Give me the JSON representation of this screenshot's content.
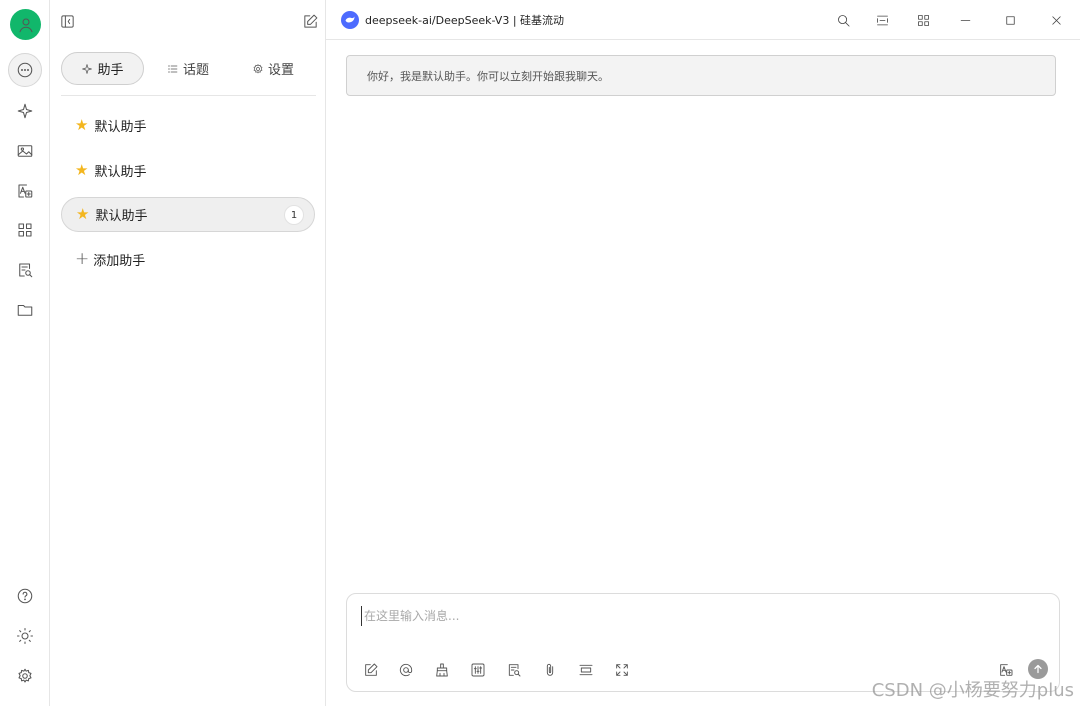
{
  "rail": {
    "icons": [
      "chat-icon",
      "sparkle-icon",
      "image-icon",
      "translate-icon",
      "apps-icon",
      "document-search-icon",
      "folder-icon",
      "help-icon",
      "theme-icon",
      "settings-icon"
    ]
  },
  "sidebar": {
    "tabs": [
      {
        "label": "助手",
        "icon": "sparkle-icon"
      },
      {
        "label": "话题",
        "icon": "list-icon"
      },
      {
        "label": "设置",
        "icon": "gear-icon"
      }
    ],
    "assistants": [
      {
        "name": "默认助手",
        "emoji": "★"
      },
      {
        "name": "默认助手",
        "emoji": "★"
      },
      {
        "name": "默认助手",
        "emoji": "★",
        "badge": "1"
      }
    ],
    "add_label": "添加助手"
  },
  "header": {
    "model": "deepseek-ai/DeepSeek-V3 | 硅基流动"
  },
  "chat": {
    "greeting": "你好，我是默认助手。你可以立刻开始跟我聊天。"
  },
  "composer": {
    "placeholder": "在这里输入消息..."
  },
  "watermark": "CSDN @小杨要努力plus",
  "colors": {
    "avatar": "#11b76b",
    "model_logo": "#4d6bfe",
    "star": "#f3b61f",
    "send_button": "#9a9a9a"
  }
}
